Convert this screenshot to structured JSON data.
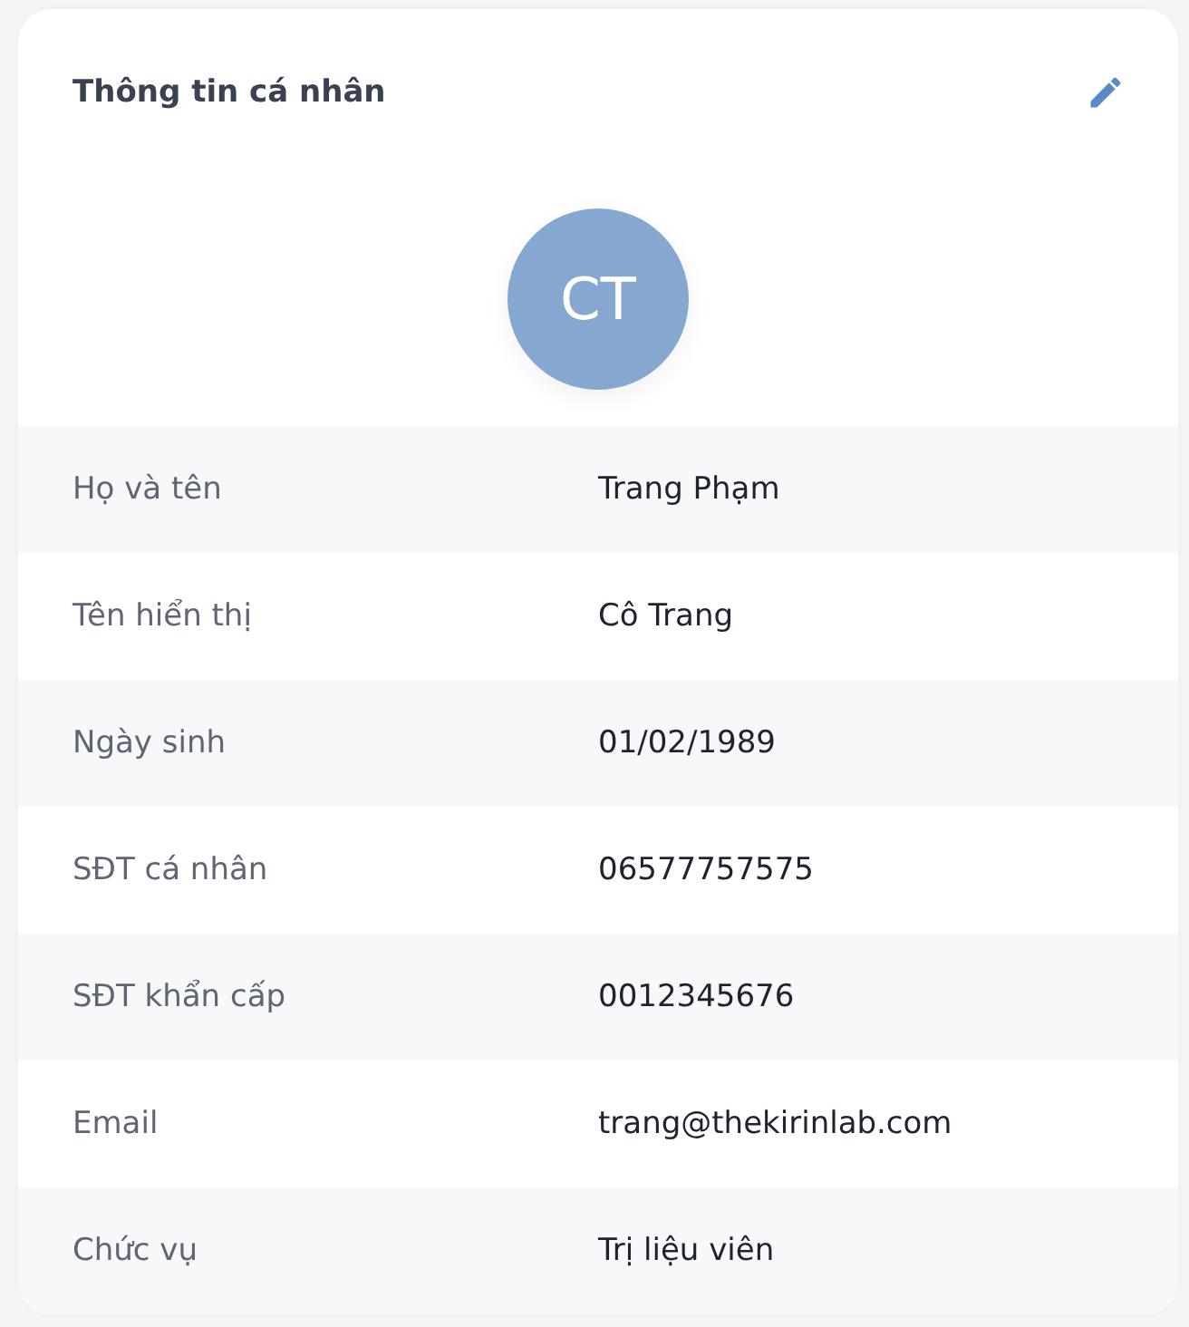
{
  "card": {
    "title": "Thông tin cá nhân",
    "avatar_initials": "CT"
  },
  "fields": [
    {
      "label": "Họ và tên",
      "value": "Trang Phạm"
    },
    {
      "label": "Tên hiển thị",
      "value": "Cô Trang"
    },
    {
      "label": "Ngày sinh",
      "value": "01/02/1989"
    },
    {
      "label": "SĐT cá nhân",
      "value": "06577757575"
    },
    {
      "label": "SĐT khẩn cấp",
      "value": "0012345676"
    },
    {
      "label": "Email",
      "value": "trang@thekirinlab.com"
    },
    {
      "label": "Chức vụ",
      "value": "Trị liệu viên"
    }
  ]
}
